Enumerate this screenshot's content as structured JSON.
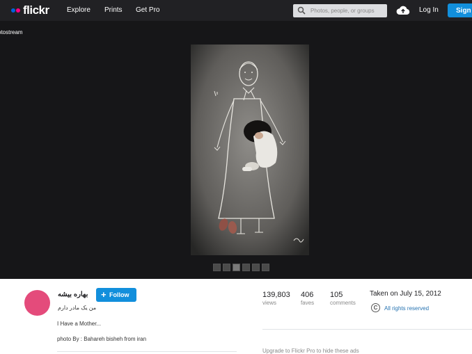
{
  "header": {
    "logo_text": "flickr",
    "nav": [
      "Explore",
      "Prints",
      "Get Pro"
    ],
    "search_placeholder": "Photos, people, or groups",
    "login_label": "Log In",
    "signup_label": "Sign Up"
  },
  "viewer": {
    "back_link": "otostream",
    "thumbnail_count": 6
  },
  "photo_info": {
    "author_name": "بهاره بیشه",
    "follow_label": "Follow",
    "title": "من یک مادر دارم",
    "description_line1": "I Have a Mother...",
    "description_line2": "photo By : Bahareh bisheh from iran",
    "stats": [
      {
        "value": "139,803",
        "label": "views"
      },
      {
        "value": "406",
        "label": "faves"
      },
      {
        "value": "105",
        "label": "comments"
      }
    ],
    "taken_on": "Taken on July 15, 2012",
    "license": "All rights reserved",
    "upgrade_text": "Upgrade to Flickr Pro to hide these ads"
  },
  "colors": {
    "nav_bg": "#212124",
    "viewer_bg": "#161618",
    "accent_blue": "#128fdc",
    "avatar_pink": "#e44b7b"
  }
}
